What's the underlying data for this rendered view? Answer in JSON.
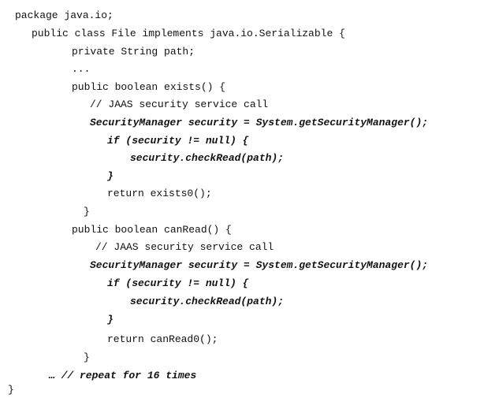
{
  "code": {
    "l1": "package java.io;",
    "l2": "public class File implements java.io.Serializable {",
    "l3": "private String path;",
    "l4": "...",
    "l5": "public boolean exists() {",
    "l6": "// JAAS security service call",
    "l7": "SecurityManager security = System.getSecurityManager();",
    "l8": "if (security != null) {",
    "l9": "security.checkRead(path);",
    "l10": "}",
    "l11": "return exists0();",
    "l12": "}",
    "l13": "public boolean canRead() {",
    "l14": "// JAAS security service call",
    "l15": "SecurityManager security = System.getSecurityManager();",
    "l16": "if (security != null) {",
    "l17": "security.checkRead(path);",
    "l18": "}",
    "l19": "return canRead0();",
    "l20": "}",
    "l21": "… // repeat for 16 times",
    "l22": "}"
  }
}
